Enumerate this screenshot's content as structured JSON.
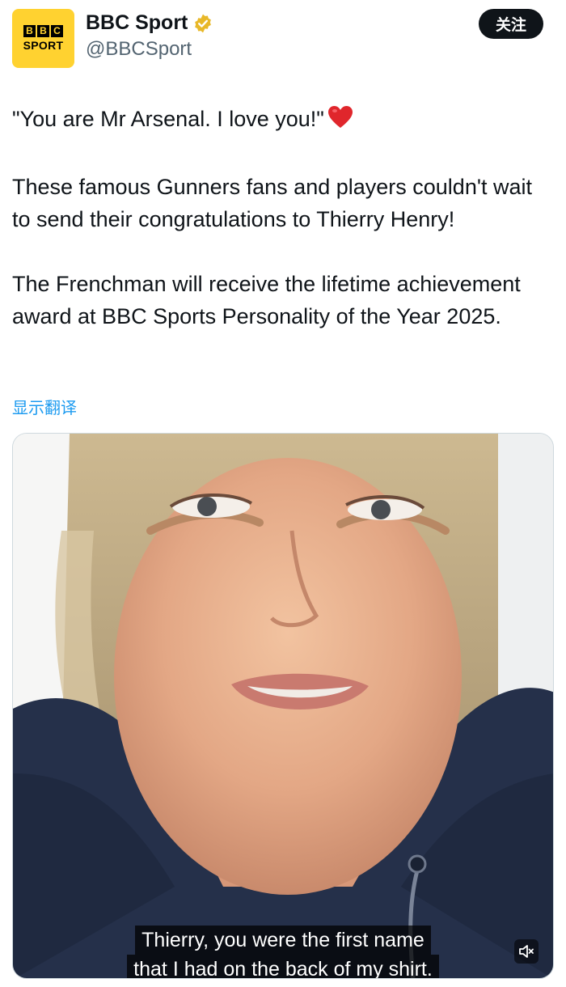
{
  "header": {
    "avatar": {
      "logo_letters": [
        "B",
        "B",
        "C"
      ],
      "logo_word": "SPORT",
      "bg_color": "#ffd230"
    },
    "display_name": "BBC Sport",
    "verified_icon": "gold-verified-badge-icon",
    "handle": "@BBCSport",
    "follow_label": "关注"
  },
  "tweet": {
    "line1": "\"You are Mr Arsenal. I love you!\"",
    "line1_emoji": "heart-icon",
    "paragraph2": "These famous Gunners fans and players couldn't wait to send their congratulations to Thierry Henry!",
    "paragraph3": "The Frenchman will receive the lifetime achievement award at BBC Sports Personality of the Year 2025."
  },
  "translate_label": "显示翻译",
  "video": {
    "subtitle_line1": "Thierry, you were the first name",
    "subtitle_line2": "that I had on the back of my shirt.",
    "mute_icon": "speaker-muted-icon"
  },
  "colors": {
    "text": "#0f1419",
    "secondary": "#536471",
    "link": "#1d9bf0",
    "verified": "#e8b829"
  }
}
